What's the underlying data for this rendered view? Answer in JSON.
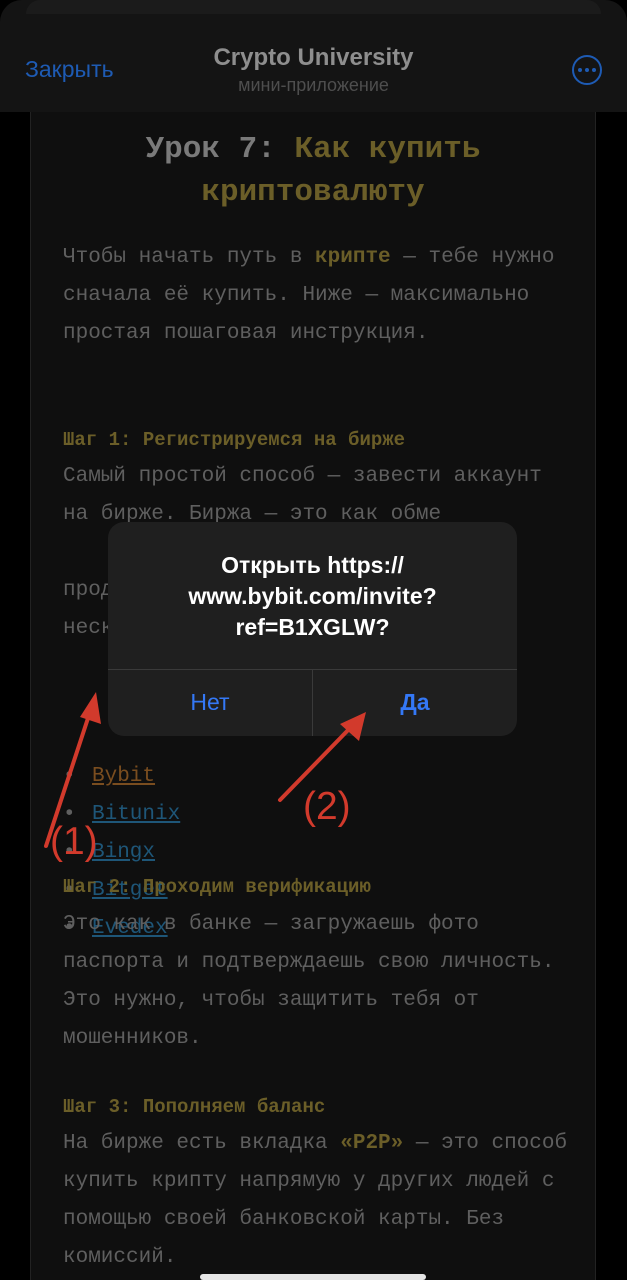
{
  "header": {
    "close_label": "Закрыть",
    "title": "Crypto University",
    "subtitle": "мини-приложение",
    "more_icon": "ellipsis-circle-icon"
  },
  "lesson": {
    "title_prefix": "Урок 7: ",
    "title_highlight": "Как купить криптовалюту",
    "intro_before": "Чтобы начать путь в ",
    "intro_bold": "крипте",
    "intro_after": " — тебе нужно сначала её купить. Ниже — максимально простая пошаговая инструкция.",
    "step1_heading": "Шаг 1: Регистрируемся на бирже",
    "step1_text": "Самый простой способ — завести аккаунт на бирже. Биржа — это как обме",
    "step1_line3": "прод",
    "step1_line4": "неск",
    "exchanges": [
      "Bybit",
      "Bitunix",
      "Bingx",
      "Bitget",
      "Evedex"
    ],
    "step2_heading": "Шаг 2: Проходим верификацию",
    "step2_text": "Это как в банке — загружаешь фото паспорта и подтверждаешь свою личность. Это нужно, чтобы защитить тебя от мошенников.",
    "step3_heading": "Шаг 3: Пополняем баланс",
    "step3_before": "На бирже есть вкладка ",
    "step3_bold": "«P2P»",
    "step3_after": " — это способ купить крипту напрямую у других людей с помощью своей банковской карты. Без комиссий."
  },
  "dialog": {
    "message": "Открыть https:// www.bybit.com/invite? ref=B1XGLW?",
    "no_label": "Нет",
    "yes_label": "Да"
  },
  "annotations": {
    "label1": "(1)",
    "label2": "(2)",
    "color": "#d23a2c"
  }
}
